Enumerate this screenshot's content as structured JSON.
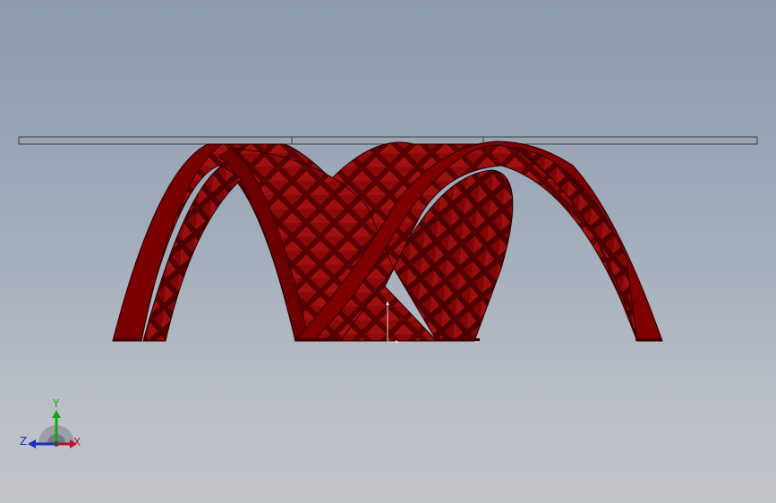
{
  "viewport": {
    "background_top": "#8b9bae",
    "background_bottom": "#c3c5ca"
  },
  "model": {
    "part_color": "#7a0000",
    "part_dark": "#4a0000",
    "glass_color": "#9aa3ae"
  },
  "triad": {
    "x_label": "X",
    "y_label": "Y",
    "z_label": "Z",
    "x_color": "#c0102a",
    "y_color": "#17a317",
    "z_color": "#1a2ec0"
  }
}
